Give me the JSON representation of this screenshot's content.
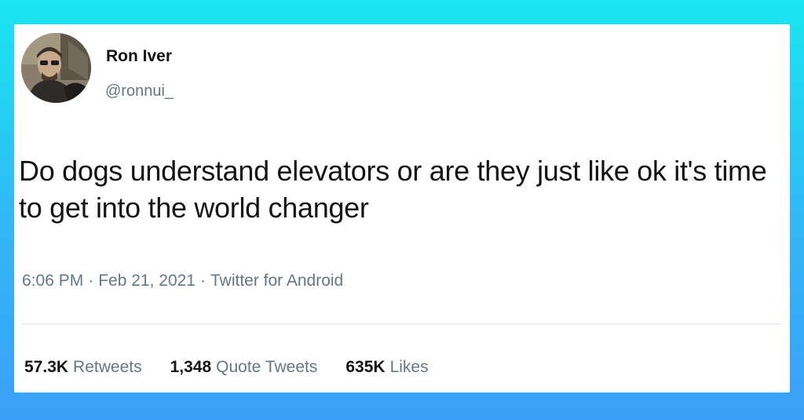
{
  "tweet": {
    "author_name": "Ron Iver",
    "author_handle": "@ronnui_",
    "text": "Do dogs understand elevators or are they just like ok it's time to get into the world changer",
    "time": "6:06 PM",
    "date": "Feb 21, 2021",
    "separator": "·",
    "source": "Twitter for Android"
  },
  "stats": [
    {
      "count": "57.3K",
      "label": "Retweets"
    },
    {
      "count": "1,348",
      "label": "Quote Tweets"
    },
    {
      "count": "635K",
      "label": "Likes"
    }
  ],
  "colors": {
    "background_top": "#19e6f0",
    "background_bottom": "#3aa0f7",
    "card": "#ffffff",
    "text_primary": "#141414",
    "text_secondary": "#657786"
  },
  "icons": {
    "avatar": "profile-photo"
  }
}
